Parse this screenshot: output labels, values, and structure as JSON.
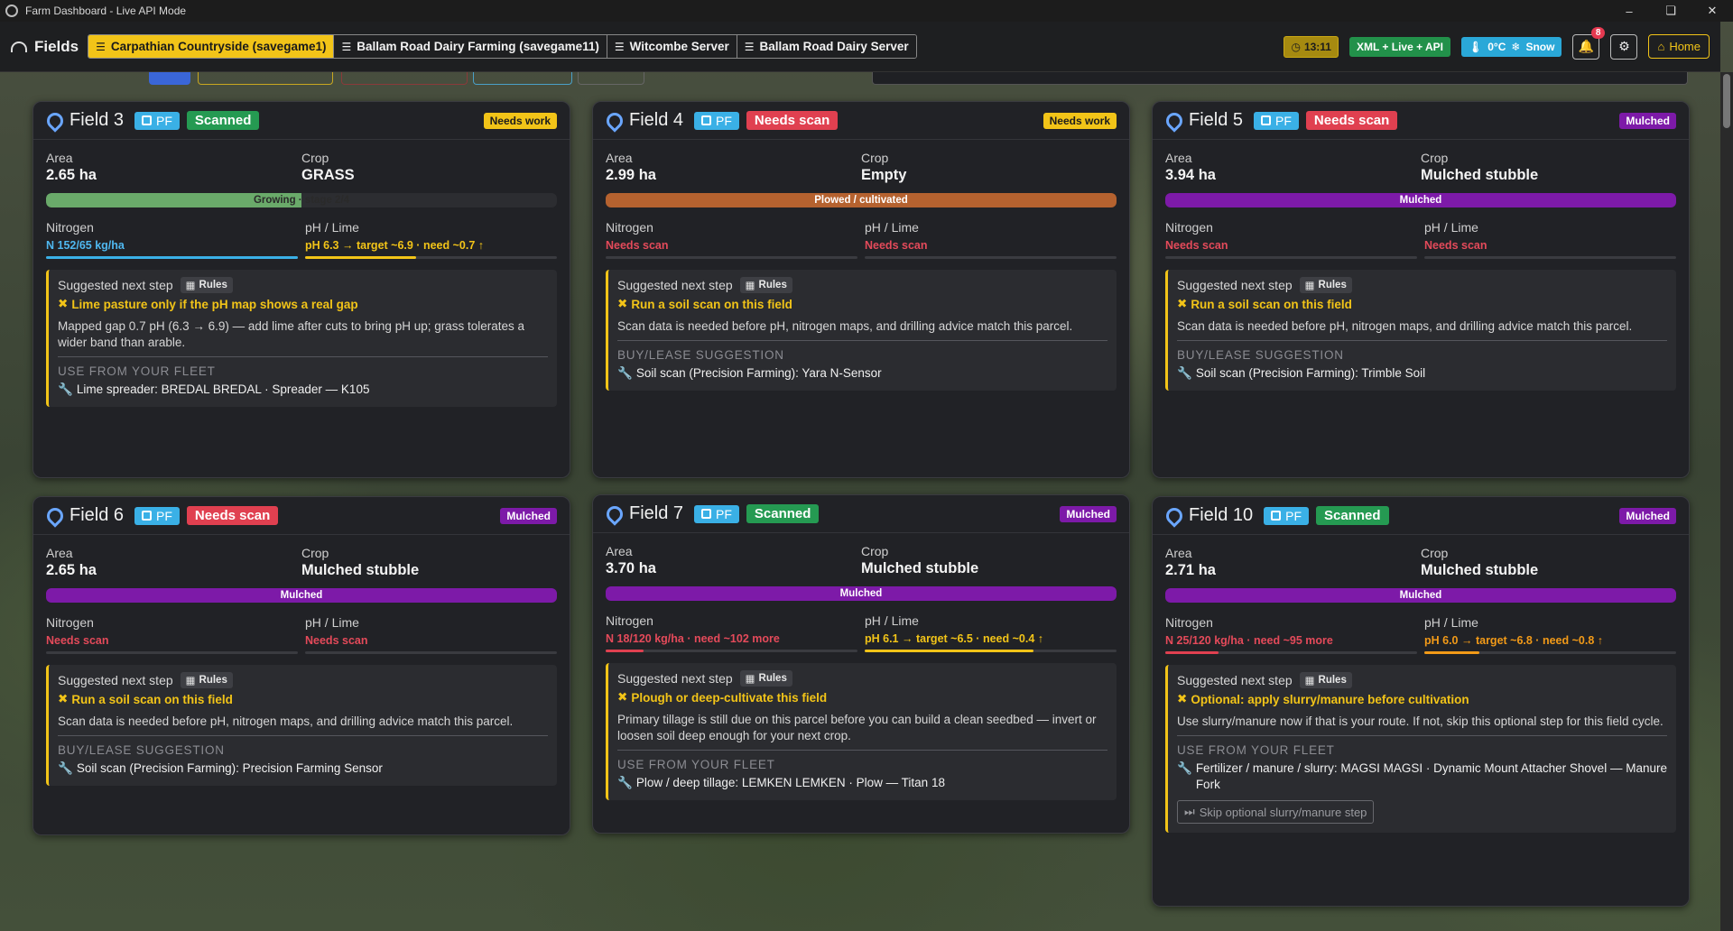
{
  "window": {
    "title": "Farm Dashboard - Live API Mode"
  },
  "nav": {
    "brand": "Fields",
    "saves": [
      {
        "label": "Carpathian Countryside (savegame1)",
        "active": true
      },
      {
        "label": "Ballam Road Dairy Farming (savegame11)",
        "active": false
      },
      {
        "label": "Witcombe Server",
        "active": false
      },
      {
        "label": "Ballam Road Dairy Server",
        "active": false
      }
    ],
    "time": "13:11",
    "api_mode": "XML + Live + API",
    "temperature": "0°C",
    "weather": "Snow",
    "notifications": "8",
    "home": "Home"
  },
  "cards": [
    {
      "name": "Field 3",
      "pf": "PF",
      "scan": "Scanned",
      "status": "Needs work",
      "area_label": "Area",
      "area": "2.65 ha",
      "crop_label": "Crop",
      "crop": "GRASS",
      "stage": "Growing · stage 2/4",
      "stage_progress": 0.5,
      "n_label": "Nitrogen",
      "n": "N 152/65 kg/ha",
      "n_fill": 1.0,
      "ph_label": "pH / Lime",
      "ph": "pH 6.3 → target ~6.9 · need ~0.7 ↑",
      "ph_fill": 0.44,
      "sug_label": "Suggested next step",
      "rules": "Rules",
      "sug_title": "Lime pasture only if the pH map shows a real gap",
      "sug_text": "Mapped gap 0.7 pH (6.3 → 6.9) — add lime after cuts to bring pH up; grass tolerates a wider band than arable.",
      "sec_label": "USE FROM YOUR FLEET",
      "sec_item": "Lime spreader: BREDAL BREDAL · Spreader — K105"
    },
    {
      "name": "Field 4",
      "pf": "PF",
      "scan": "Needs scan",
      "status": "Needs work",
      "area_label": "Area",
      "area": "2.99 ha",
      "crop_label": "Crop",
      "crop": "Empty",
      "stage": "Plowed / cultivated",
      "n_label": "Nitrogen",
      "n": "Needs scan",
      "ph_label": "pH / Lime",
      "ph": "Needs scan",
      "sug_label": "Suggested next step",
      "rules": "Rules",
      "sug_title": "Run a soil scan on this field",
      "sug_text": "Scan data is needed before pH, nitrogen maps, and drilling advice match this parcel.",
      "sec_label": "BUY/LEASE SUGGESTION",
      "sec_item": "Soil scan (Precision Farming): Yara N-Sensor"
    },
    {
      "name": "Field 5",
      "pf": "PF",
      "scan": "Needs scan",
      "status": "Mulched",
      "area_label": "Area",
      "area": "3.94 ha",
      "crop_label": "Crop",
      "crop": "Mulched stubble",
      "stage": "Mulched",
      "n_label": "Nitrogen",
      "n": "Needs scan",
      "ph_label": "pH / Lime",
      "ph": "Needs scan",
      "sug_label": "Suggested next step",
      "rules": "Rules",
      "sug_title": "Run a soil scan on this field",
      "sug_text": "Scan data is needed before pH, nitrogen maps, and drilling advice match this parcel.",
      "sec_label": "BUY/LEASE SUGGESTION",
      "sec_item": "Soil scan (Precision Farming): Trimble Soil"
    },
    {
      "name": "Field 6",
      "pf": "PF",
      "scan": "Needs scan",
      "status": "Mulched",
      "area_label": "Area",
      "area": "2.65 ha",
      "crop_label": "Crop",
      "crop": "Mulched stubble",
      "stage": "Mulched",
      "n_label": "Nitrogen",
      "n": "Needs scan",
      "ph_label": "pH / Lime",
      "ph": "Needs scan",
      "sug_label": "Suggested next step",
      "rules": "Rules",
      "sug_title": "Run a soil scan on this field",
      "sug_text": "Scan data is needed before pH, nitrogen maps, and drilling advice match this parcel.",
      "sec_label": "BUY/LEASE SUGGESTION",
      "sec_item": "Soil scan (Precision Farming): Precision Farming Sensor"
    },
    {
      "name": "Field 7",
      "pf": "PF",
      "scan": "Scanned",
      "status": "Mulched",
      "area_label": "Area",
      "area": "3.70 ha",
      "crop_label": "Crop",
      "crop": "Mulched stubble",
      "stage": "Mulched",
      "n_label": "Nitrogen",
      "n": "N 18/120 kg/ha · need ~102 more",
      "n_fill": 0.15,
      "ph_label": "pH / Lime",
      "ph": "pH 6.1 → target ~6.5 · need ~0.4 ↑",
      "ph_fill": 0.67,
      "sug_label": "Suggested next step",
      "rules": "Rules",
      "sug_title": "Plough or deep-cultivate this field",
      "sug_text": "Primary tillage is still due on this parcel before you can build a clean seedbed — invert or loosen soil deep enough for your next crop.",
      "sec_label": "USE FROM YOUR FLEET",
      "sec_item": "Plow / deep tillage: LEMKEN LEMKEN · Plow — Titan 18"
    },
    {
      "name": "Field 10",
      "pf": "PF",
      "scan": "Scanned",
      "status": "Mulched",
      "area_label": "Area",
      "area": "2.71 ha",
      "crop_label": "Crop",
      "crop": "Mulched stubble",
      "stage": "Mulched",
      "n_label": "Nitrogen",
      "n": "N 25/120 kg/ha · need ~95 more",
      "n_fill": 0.21,
      "ph_label": "pH / Lime",
      "ph": "pH 6.0 → target ~6.8 · need ~0.8 ↑",
      "ph_fill": 0.22,
      "sug_label": "Suggested next step",
      "rules": "Rules",
      "sug_title": "Optional: apply slurry/manure before cultivation",
      "sug_text": "Use slurry/manure now if that is your route. If not, skip this optional step for this field cycle.",
      "sec_label": "USE FROM YOUR FLEET",
      "sec_item": "Fertilizer / manure / slurry: MAGSI MAGSI · Dynamic Mount Attacher Shovel — Manure Fork",
      "skip": "Skip optional slurry/manure step"
    }
  ],
  "colors": {
    "accent": "#f2c418",
    "pf": "#3ab0e6",
    "scanned": "#259a52",
    "needs_scan": "#e04050",
    "mulched": "#7d1aa8",
    "plowed": "#b5622f",
    "growing": "#6aaa6a"
  }
}
